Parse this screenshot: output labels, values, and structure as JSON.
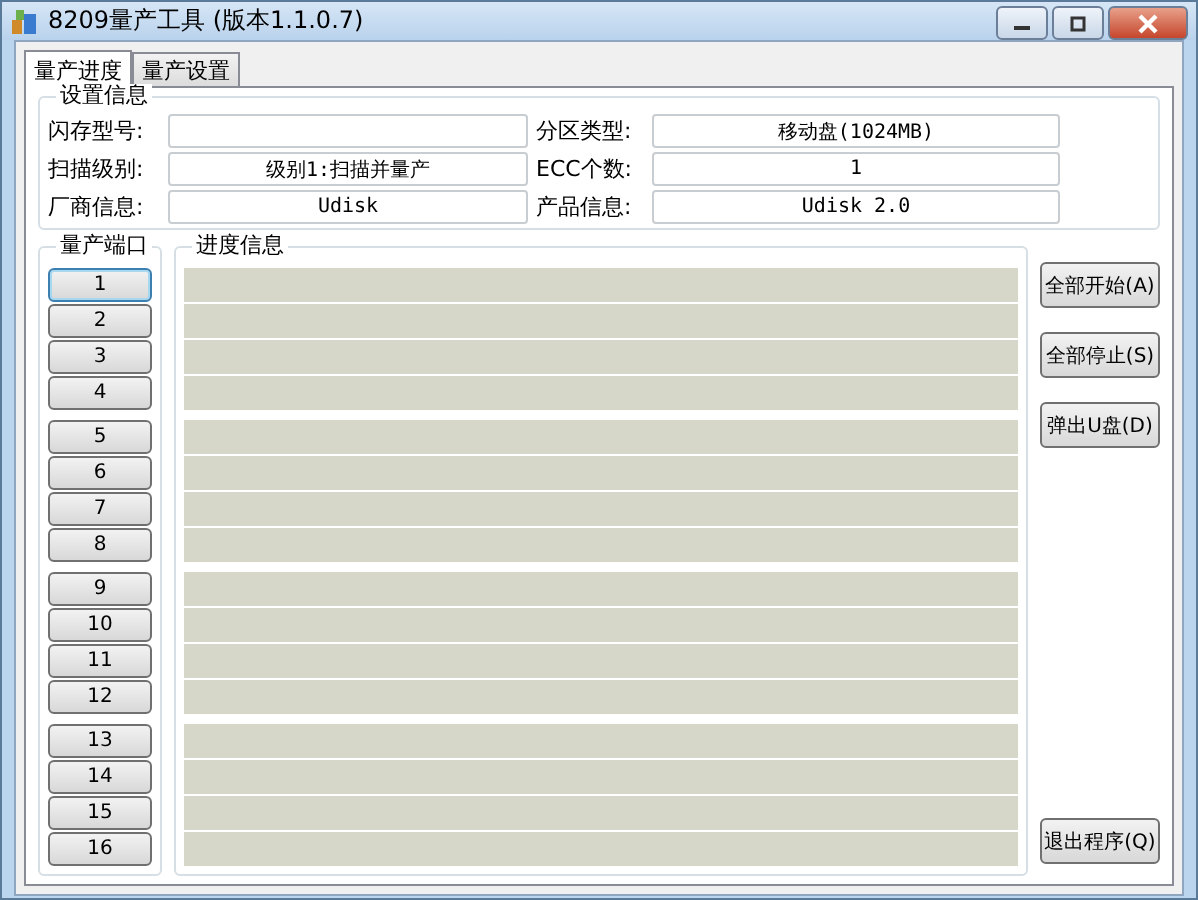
{
  "window": {
    "title": "8209量产工具 (版本1.1.0.7)"
  },
  "tabs": [
    {
      "label": "量产进度",
      "selected": true
    },
    {
      "label": "量产设置",
      "selected": false
    }
  ],
  "settings": {
    "title": "设置信息",
    "fields": [
      {
        "label": "闪存型号:"
      },
      {
        "label": "分区类型:",
        "value": "移动盘(1024MB)"
      },
      {
        "label": "扫描级别:",
        "value": "级别1:扫描并量产"
      },
      {
        "label": "ECC个数:",
        "value": "1"
      },
      {
        "label": "厂商信息:",
        "value": "Udisk"
      },
      {
        "label": "产品信息:",
        "value": "Udisk 2.0"
      }
    ]
  },
  "ports": {
    "title": "量产端口",
    "groups": [
      [
        {
          "label": "1",
          "selected": true,
          "level": 0
        },
        {
          "label": "2",
          "selected": false,
          "level": 0
        },
        {
          "label": "3",
          "selected": false,
          "level": 0
        },
        {
          "label": "4",
          "selected": false,
          "level": 0
        }
      ],
      [
        {
          "label": "5",
          "selected": false,
          "level": 0
        },
        {
          "label": "6",
          "selected": false,
          "level": 0
        },
        {
          "label": "7",
          "selected": false,
          "level": 0
        },
        {
          "label": "8",
          "selected": false,
          "level": 0
        }
      ],
      [
        {
          "label": "9",
          "selected": false,
          "level": 0
        },
        {
          "label": "10",
          "selected": false,
          "level": 0
        },
        {
          "label": "11",
          "selected": false,
          "level": 0
        },
        {
          "label": "12",
          "selected": false,
          "level": 0
        }
      ],
      [
        {
          "label": "13",
          "selected": false,
          "level": 0
        },
        {
          "label": "14",
          "selected": false,
          "level": 0
        },
        {
          "label": "15",
          "selected": false,
          "level": 0
        },
        {
          "label": "16",
          "selected": false,
          "level": 0
        }
      ]
    ]
  },
  "progress": {
    "title": "进度信息"
  },
  "actions": [
    "全部开始(A)",
    "全部停止(S)",
    "弹出U盘(D)"
  ],
  "exit_button": "退出程序(Q)"
}
